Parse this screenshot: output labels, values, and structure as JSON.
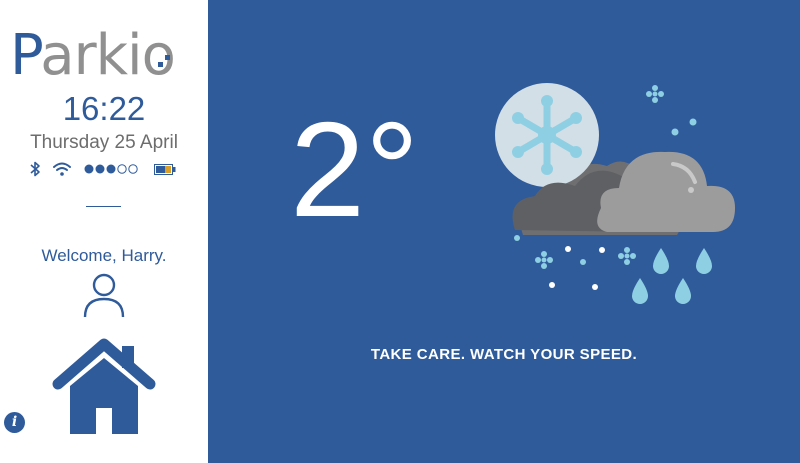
{
  "app": {
    "logo_first": "P",
    "logo_rest": "arkio"
  },
  "clock": {
    "time": "16:22",
    "date": "Thursday 25 April"
  },
  "status": {
    "icons": [
      "bluetooth-icon",
      "wifi-icon",
      "signal-dots-icon",
      "battery-icon"
    ],
    "signal_strength_filled": 3,
    "signal_strength_total": 5
  },
  "user": {
    "welcome": "Welcome, Harry."
  },
  "weather": {
    "temperature": "2°",
    "condition_icon": "snow-rain-cloud-icon",
    "message": "TAKE CARE.  WATCH YOUR SPEED."
  },
  "colors": {
    "brand_blue": "#2f5b9b",
    "logo_gray": "#909090",
    "background_white": "#ffffff"
  }
}
